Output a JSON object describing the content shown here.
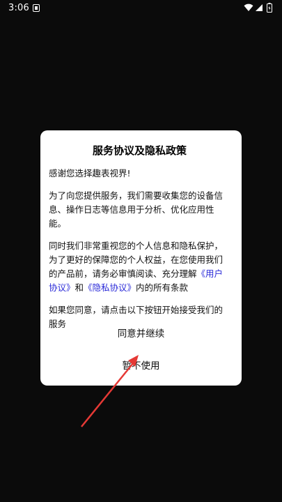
{
  "status_bar": {
    "time": "3:06",
    "icons": [
      "notification-icon",
      "wifi-icon",
      "signal-icon",
      "battery-icon"
    ]
  },
  "dialog": {
    "title": "服务协议及隐私政策",
    "greeting": "感谢您选择趣表视界!",
    "para_data": "为了向您提供服务，我们需要收集您的设备信息、操作日志等信息用于分析、优化应用性能。",
    "para_privacy_prefix": "同时我们非常重视您的个人信息和隐私保护，为了更好的保障您的个人权益，在您使用我们的产品前，请务必审慎阅读、充分理解",
    "user_agreement_link": "《用户协议》",
    "and_word": "和",
    "privacy_policy_link": "《隐私协议》",
    "para_privacy_suffix": "内的所有条款",
    "para_consent": "如果您同意，请点击以下按钮开始接受我们的服务",
    "agree_button": "同意并继续",
    "decline_button": "暂不使用"
  },
  "colors": {
    "background": "#0b0b0b",
    "dialog": "#ffffff",
    "link": "#2a2ad8",
    "arrow": "#e53935"
  }
}
